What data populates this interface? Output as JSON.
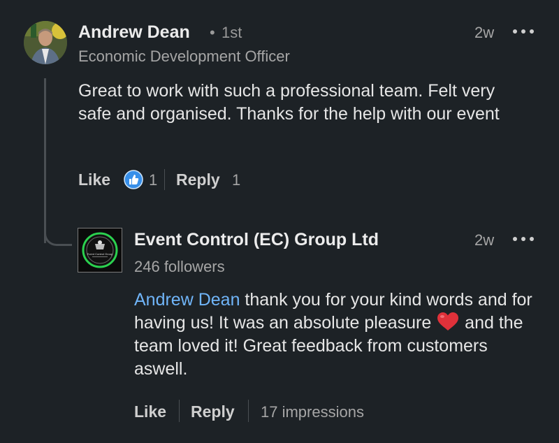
{
  "comment": {
    "author": "Andrew Dean",
    "separator": "•",
    "degree": "1st",
    "headline": "Economic Development Officer",
    "time": "2w",
    "text": "Great to work with such a professional team. Felt very safe and organised. Thanks for the help with our event",
    "like_label": "Like",
    "reaction_count": "1",
    "reply_label": "Reply",
    "reply_count": "1"
  },
  "reply": {
    "author": "Event Control (EC) Group Ltd",
    "followers": "246 followers",
    "time": "2w",
    "mention": "Andrew Dean",
    "text_part1": " thank you for your kind words and for having us! It was an absolute pleasure ",
    "emoji": "❤️",
    "text_part2": " and the team loved it! Great feedback from customers aswell.",
    "logo_text": "Event Control Group",
    "like_label": "Like",
    "reply_label": "Reply",
    "impressions": "17 impressions"
  },
  "colors": {
    "background": "#1d2226",
    "mention": "#70b5f9",
    "like_icon": "#378fe9",
    "heart": "#e0313a",
    "logo_ring": "#2bd14f"
  },
  "icons": {
    "more": "more-horizontal-icon",
    "like_reaction": "thumbs-up-icon",
    "heart": "heart-emoji-icon"
  }
}
